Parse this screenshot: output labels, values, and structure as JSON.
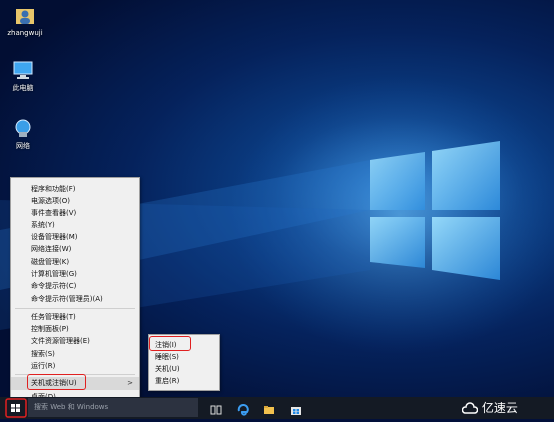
{
  "desktop": {
    "icons": [
      {
        "label": "zhangwuji",
        "icon": "user-folder-icon"
      },
      {
        "label": "此电脑",
        "icon": "computer-icon"
      },
      {
        "label": "网络",
        "icon": "network-icon"
      }
    ]
  },
  "context_menu": {
    "items": [
      "程序和功能(F)",
      "电源选项(O)",
      "事件查看器(V)",
      "系统(Y)",
      "设备管理器(M)",
      "网络连接(W)",
      "磁盘管理(K)",
      "计算机管理(G)",
      "命令提示符(C)",
      "命令提示符(管理员)(A)",
      "任务管理器(T)",
      "控制面板(P)",
      "文件资源管理器(E)",
      "搜索(S)",
      "运行(R)",
      "关机或注销(U)",
      "桌面(D)"
    ],
    "submenu_arrow": ">"
  },
  "submenu": {
    "items": [
      "注销(I)",
      "睡眠(S)",
      "关机(U)",
      "重启(R)"
    ]
  },
  "taskbar": {
    "search_placeholder": "搜索 Web 和 Windows",
    "icons": [
      "task-view-icon",
      "edge-icon",
      "file-explorer-icon",
      "store-icon"
    ]
  },
  "watermark": "亿速云",
  "colors": {
    "highlight_box": "#e02020",
    "taskbar": "#141a24",
    "menu_bg": "#f0f0f0"
  }
}
